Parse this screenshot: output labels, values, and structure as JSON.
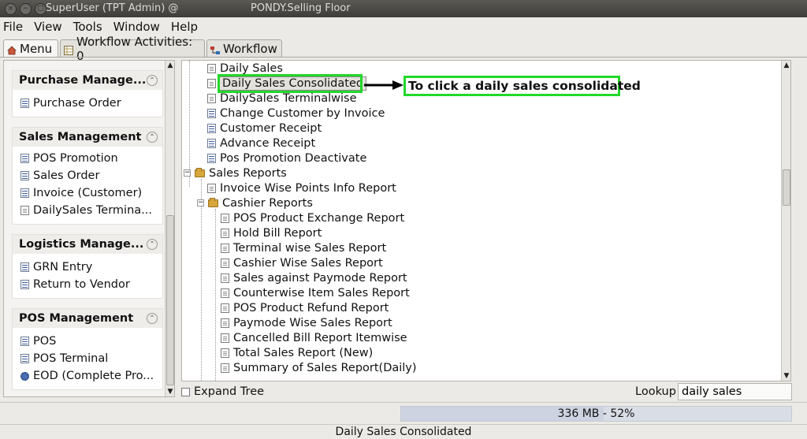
{
  "window": {
    "user_title": "SuperUser (TPT Admin) @",
    "title": "PONDY.Selling Floor"
  },
  "menubar": [
    "File",
    "View",
    "Tools",
    "Window",
    "Help"
  ],
  "tabs": [
    {
      "label": "Menu",
      "icon": "home-icon"
    },
    {
      "label": "Workflow Activities: 0",
      "icon": "table-icon"
    },
    {
      "label": "Workflow",
      "icon": "workflow-icon"
    }
  ],
  "sidebar": {
    "sections": [
      {
        "title": "Purchase Manage...",
        "items": [
          "Purchase Order"
        ]
      },
      {
        "title": "Sales Management",
        "items": [
          "POS Promotion",
          "Sales Order",
          "Invoice (Customer)",
          "DailySales Termina..."
        ]
      },
      {
        "title": "Logistics Manage...",
        "items": [
          "GRN Entry",
          "Return to Vendor"
        ]
      },
      {
        "title": "POS Management",
        "items": [
          "POS",
          "POS Terminal",
          "EOD (Complete Pro..."
        ]
      }
    ]
  },
  "tree": {
    "items": [
      {
        "label": "Daily Sales",
        "icon": "page"
      },
      {
        "label": "Daily Sales Consolidated",
        "icon": "page",
        "selected": true
      },
      {
        "label": "DailySales Terminalwise",
        "icon": "page"
      },
      {
        "label": "Change Customer by Invoice",
        "icon": "doc"
      },
      {
        "label": "Customer Receipt",
        "icon": "doc"
      },
      {
        "label": "Advance Receipt",
        "icon": "doc"
      },
      {
        "label": "Pos Promotion Deactivate",
        "icon": "doc"
      },
      {
        "label": "Sales Reports",
        "icon": "folder"
      },
      {
        "label": "Invoice Wise Points Info Report",
        "icon": "page"
      },
      {
        "label": "Cashier Reports",
        "icon": "folder"
      },
      {
        "label": "POS Product Exchange Report",
        "icon": "page"
      },
      {
        "label": "Hold Bill Report",
        "icon": "page"
      },
      {
        "label": "Terminal wise Sales Report",
        "icon": "page"
      },
      {
        "label": "Cashier Wise Sales Report",
        "icon": "page"
      },
      {
        "label": "Sales against Paymode Report",
        "icon": "page"
      },
      {
        "label": "Counterwise Item Sales Report",
        "icon": "page"
      },
      {
        "label": "POS Product Refund Report",
        "icon": "page"
      },
      {
        "label": "Paymode Wise Sales Report",
        "icon": "page"
      },
      {
        "label": "Cancelled Bill Report Itemwise",
        "icon": "page"
      },
      {
        "label": "Total Sales Report (New)",
        "icon": "page"
      },
      {
        "label": "Summary of Sales Report(Daily)",
        "icon": "page"
      }
    ]
  },
  "annotation": "To click a daily sales consolidated",
  "expand_tree_label": "Expand Tree",
  "lookup": {
    "label": "Lookup",
    "value": "daily sales"
  },
  "memory": {
    "text": "336 MB - 52%",
    "percent": 52
  },
  "status": "Daily Sales Consolidated",
  "colors": {
    "highlight": "#22d82a"
  }
}
